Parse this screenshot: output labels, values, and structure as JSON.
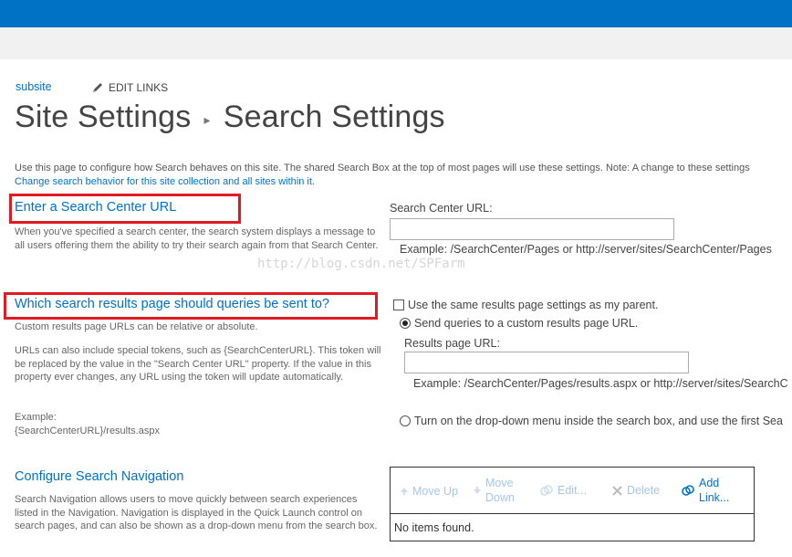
{
  "header": {
    "breadcrumb_link": "subsite",
    "edit_links_label": "EDIT LINKS",
    "title_parent": "Site Settings",
    "title_separator": "▸",
    "title_current": "Search Settings"
  },
  "intro": {
    "text": "Use this page to configure how Search behaves on this site. The shared Search Box at the top of most pages will use these settings. Note: A change to these settings",
    "link": "Change search behavior for this site collection and all sites within it."
  },
  "search_center": {
    "heading": "Enter a Search Center URL",
    "description": "When you've specified a search center, the search system displays a message to all users offering them the ability to try their search again from that Search Center.",
    "field_label": "Search Center URL:",
    "field_value": "",
    "example": "Example: /SearchCenter/Pages or http://server/sites/SearchCenter/Pages"
  },
  "watermark": "http://blog.csdn.net/SPFarm",
  "results_page": {
    "heading": "Which search results page should queries be sent to?",
    "description_1": "Custom results page URLs can be relative or absolute.",
    "description_2": "URLs can also include special tokens, such as {SearchCenterURL}. This token will be replaced by the value in the \"Search Center URL\" property. If the value in this property ever changes, any URL using the token will update automatically.",
    "example_label": "Example:",
    "example_value": "{SearchCenterURL}/results.aspx",
    "checkbox_label": "Use the same results page settings as my parent.",
    "checkbox_checked": false,
    "radio_custom_label": "Send queries to a custom results page URL.",
    "radio_custom_selected": true,
    "field_label": "Results page URL:",
    "field_value": "",
    "example": "Example: /SearchCenter/Pages/results.aspx or http://server/sites/SearchC",
    "radio_dropdown_label": "Turn on the drop-down menu inside the search box, and use the first Sea",
    "radio_dropdown_selected": false
  },
  "navigation": {
    "heading": "Configure Search Navigation",
    "description": "Search Navigation allows users to move quickly between search experiences listed in the Navigation. Navigation is displayed in the Quick Launch control on search pages, and can also be shown as a drop-down menu from the search box.",
    "toolbar": {
      "move_up": "Move Up",
      "move_down_1": "Move",
      "move_down_2": "Down",
      "edit": "Edit...",
      "delete": "Delete",
      "add_1": "Add",
      "add_2": "Link..."
    },
    "empty_message": "No items found."
  },
  "colors": {
    "suite_bar": "#0072c6",
    "link": "#0072c6",
    "highlight_box": "#e01b24",
    "disabled_tool": "#a6c7e5"
  }
}
